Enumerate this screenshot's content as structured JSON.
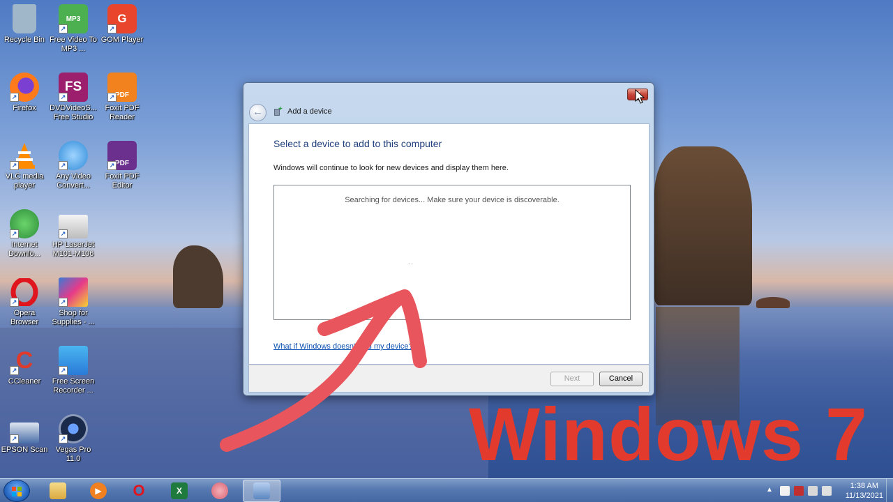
{
  "desktop": {
    "icons": [
      {
        "label": "Recycle Bin",
        "color": "#9fb7c8",
        "glyph": ""
      },
      {
        "label": "Free Video To MP3 ...",
        "color": "#4caf50",
        "glyph": "MP3"
      },
      {
        "label": "GOM Player",
        "color": "#e8452c",
        "glyph": "G"
      },
      {
        "label": "Firefox",
        "color": "#ff7a1a",
        "glyph": ""
      },
      {
        "label": "DVDVideoS... Free Studio",
        "color": "#9c1f6e",
        "glyph": "FS"
      },
      {
        "label": "Foxit PDF Reader",
        "color": "#f2821e",
        "glyph": "PDF"
      },
      {
        "label": "VLC media player",
        "color": "#ff8c00",
        "glyph": ""
      },
      {
        "label": "Any Video Convert...",
        "color": "#2e8ad8",
        "glyph": ""
      },
      {
        "label": "Foxit PDF Editor",
        "color": "#6b2f8e",
        "glyph": "PDF"
      },
      {
        "label": "Internet Downlo...",
        "color": "#2c8c3a",
        "glyph": ""
      },
      {
        "label": "HP LaserJet M101-M106",
        "color": "#d8d8d8",
        "glyph": ""
      },
      {
        "label": "Opera Browser",
        "color": "#e0161e",
        "glyph": "O"
      },
      {
        "label": "Shop for Supplies - ...",
        "color": "#3a7bd5",
        "glyph": ""
      },
      {
        "label": "CCleaner",
        "color": "#e03a2a",
        "glyph": "C"
      },
      {
        "label": "Free Screen Recorder ...",
        "color": "#2a9ad8",
        "glyph": ""
      },
      {
        "label": "EPSON Scan",
        "color": "#4a6ea8",
        "glyph": ""
      },
      {
        "label": "Vegas Pro 11.0",
        "color": "#1a2a4a",
        "glyph": ""
      }
    ]
  },
  "dialog": {
    "title": "Add a device",
    "close_glyph": "✕",
    "back_glyph": "←",
    "heading": "Select a device to add to this computer",
    "description": "Windows will continue to look for new devices and display them here.",
    "searching_text": "Searching for devices...  Make sure your device is discoverable.",
    "progress_dots": "..",
    "help_link": "What if Windows doesn't find my device?",
    "next_label": "Next",
    "cancel_label": "Cancel"
  },
  "overlay": {
    "text": "Windows 7",
    "color": "#e23a2c"
  },
  "taskbar": {
    "clock_time": "1:38 AM",
    "clock_date": "11/13/2021",
    "tray_up_glyph": "▲",
    "items": [
      {
        "name": "explorer",
        "color": "#e8c060",
        "glyph": ""
      },
      {
        "name": "media-player",
        "color": "#f08020",
        "glyph": "▶"
      },
      {
        "name": "opera",
        "color": "#e0161e",
        "glyph": "O"
      },
      {
        "name": "excel",
        "color": "#1f7a3e",
        "glyph": "X"
      },
      {
        "name": "app",
        "color": "#d86070",
        "glyph": ""
      },
      {
        "name": "add-device",
        "color": "#5a86c0",
        "glyph": ""
      }
    ]
  }
}
